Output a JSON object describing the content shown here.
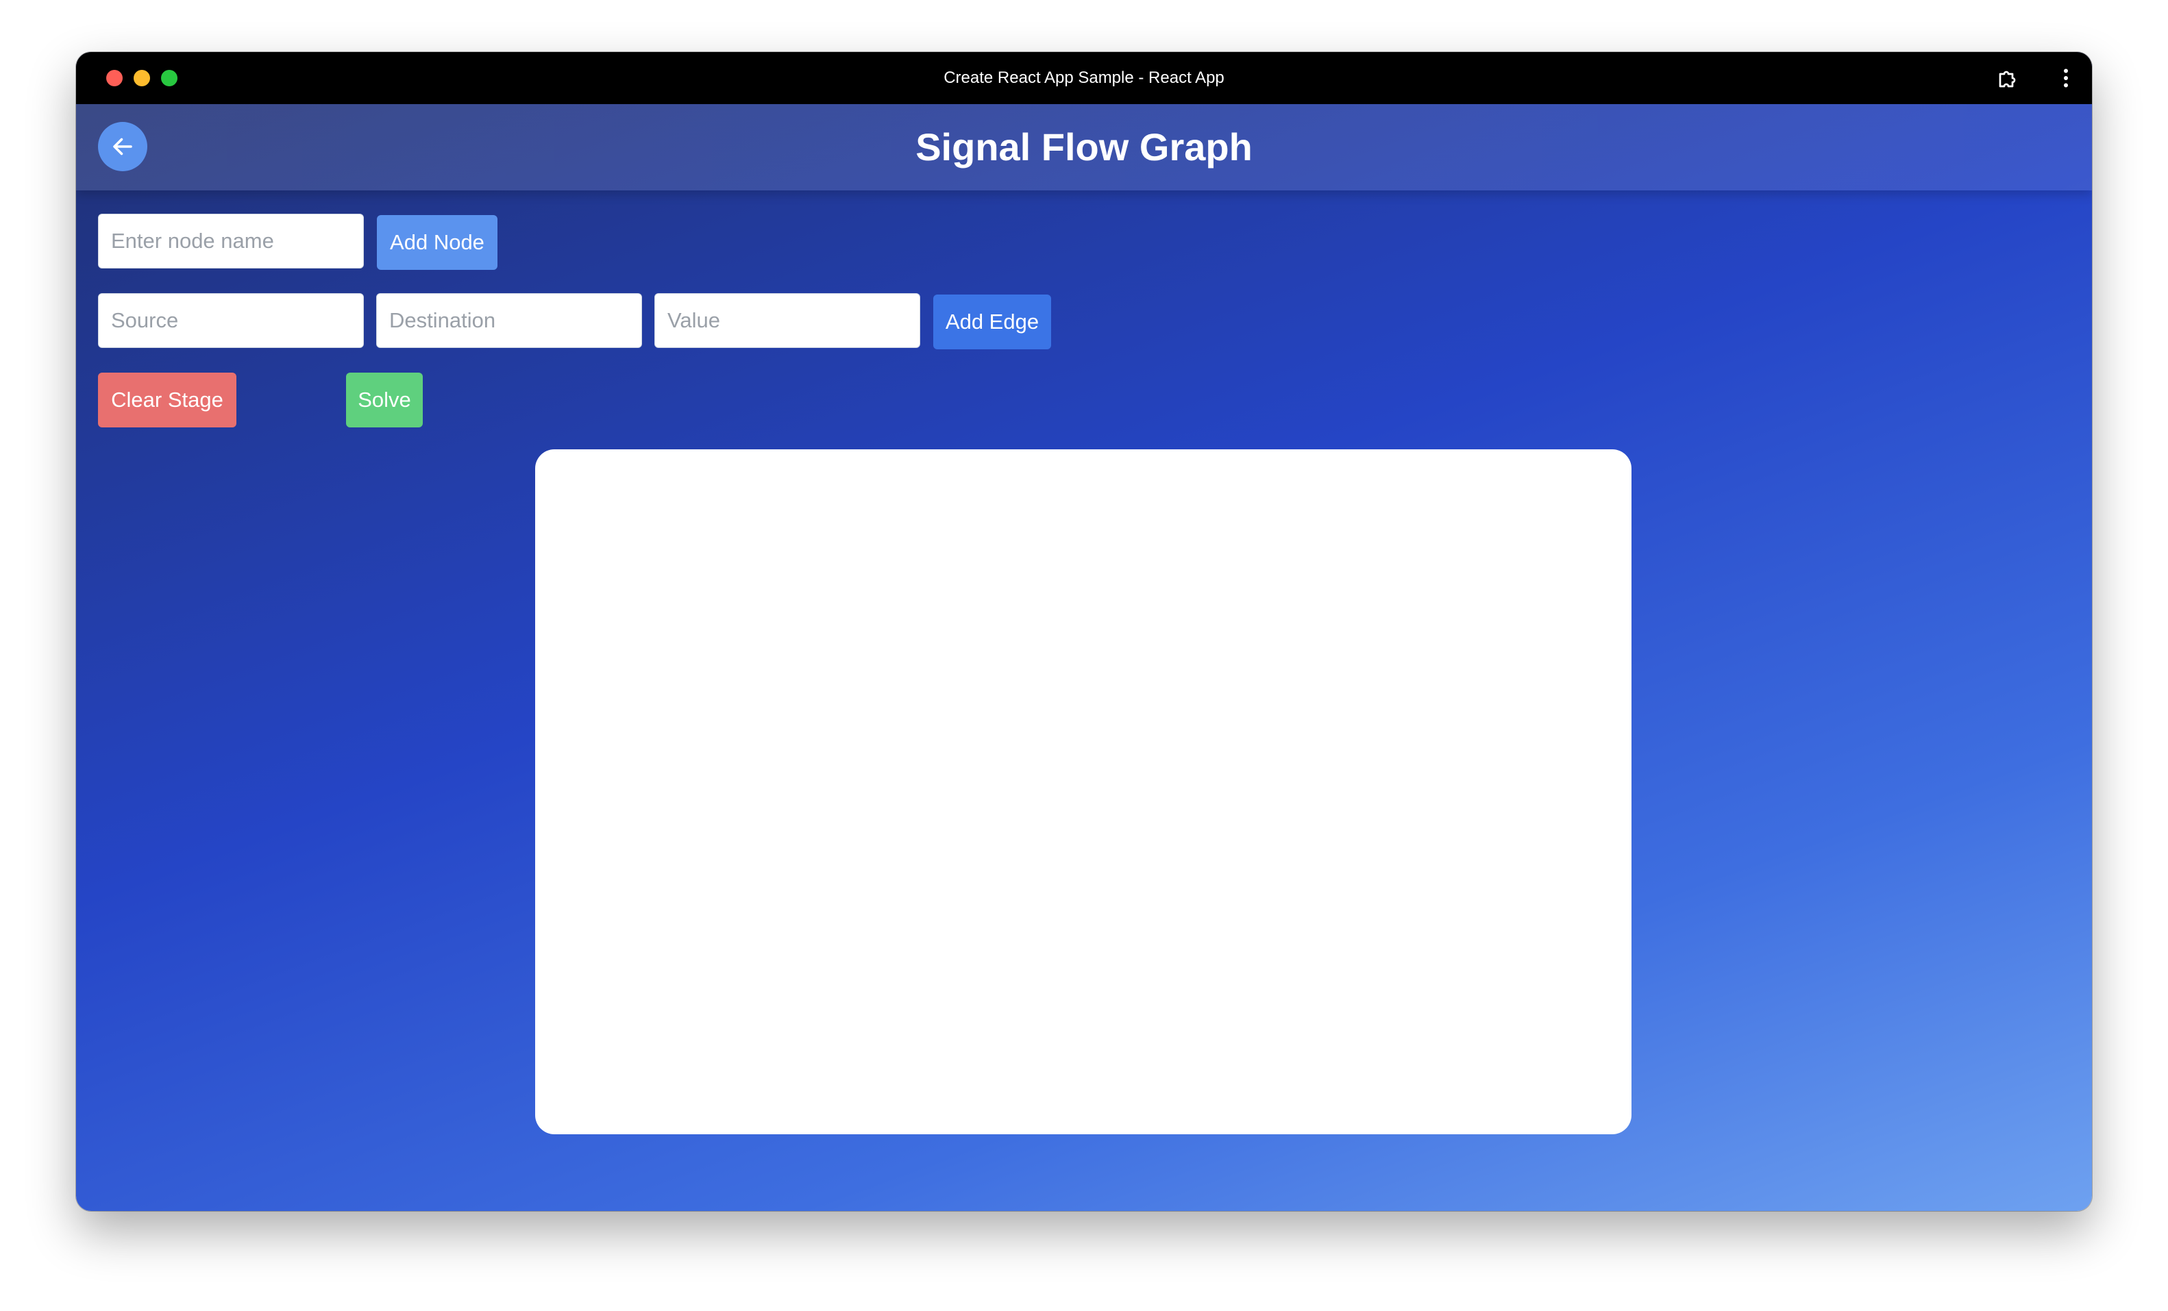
{
  "window": {
    "title": "Create React App Sample - React App",
    "icons": [
      "extension-icon",
      "more-menu-icon"
    ]
  },
  "header": {
    "title": "Signal Flow Graph",
    "back_icon": "arrow-left-icon"
  },
  "node_form": {
    "name_placeholder": "Enter node name",
    "name_value": "",
    "add_label": "Add Node"
  },
  "edge_form": {
    "source_placeholder": "Source",
    "destination_placeholder": "Destination",
    "value_placeholder": "Value",
    "add_label": "Add Edge"
  },
  "actions": {
    "clear_label": "Clear Stage",
    "solve_label": "Solve"
  },
  "colors": {
    "add_node": "#5b93ee",
    "add_edge": "#3b74e6",
    "clear": "#e8706f",
    "solve": "#5fd07e"
  }
}
